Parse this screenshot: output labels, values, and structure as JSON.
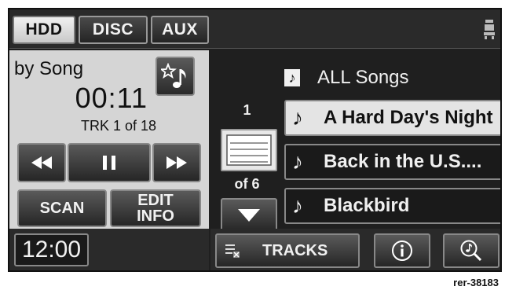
{
  "source_tabs": [
    {
      "label": "HDD",
      "active": true
    },
    {
      "label": "DISC",
      "active": false
    },
    {
      "label": "AUX",
      "active": false
    }
  ],
  "player": {
    "mode_label": "by Song",
    "elapsed_time": "00:11",
    "track_info": "TRK 1 of 18",
    "scan_label": "SCAN",
    "edit_info_line1": "EDIT",
    "edit_info_line2": "INFO"
  },
  "clock": "12:00",
  "browse": {
    "header_label": "ALL Songs",
    "page_current": "1",
    "page_total": "of 6",
    "items": [
      {
        "label": "A Hard Day's Night",
        "selected": true
      },
      {
        "label": "Back in the U.S....",
        "selected": false
      },
      {
        "label": "Blackbird",
        "selected": false
      }
    ]
  },
  "bottom_bar": {
    "tracks_label": "TRACKS"
  },
  "reference_code": "rer-38183",
  "colors": {
    "screen_bg": "#1f1f1f",
    "panel_light": "#d5d5d5",
    "selected_item": "#e4e4e4"
  }
}
